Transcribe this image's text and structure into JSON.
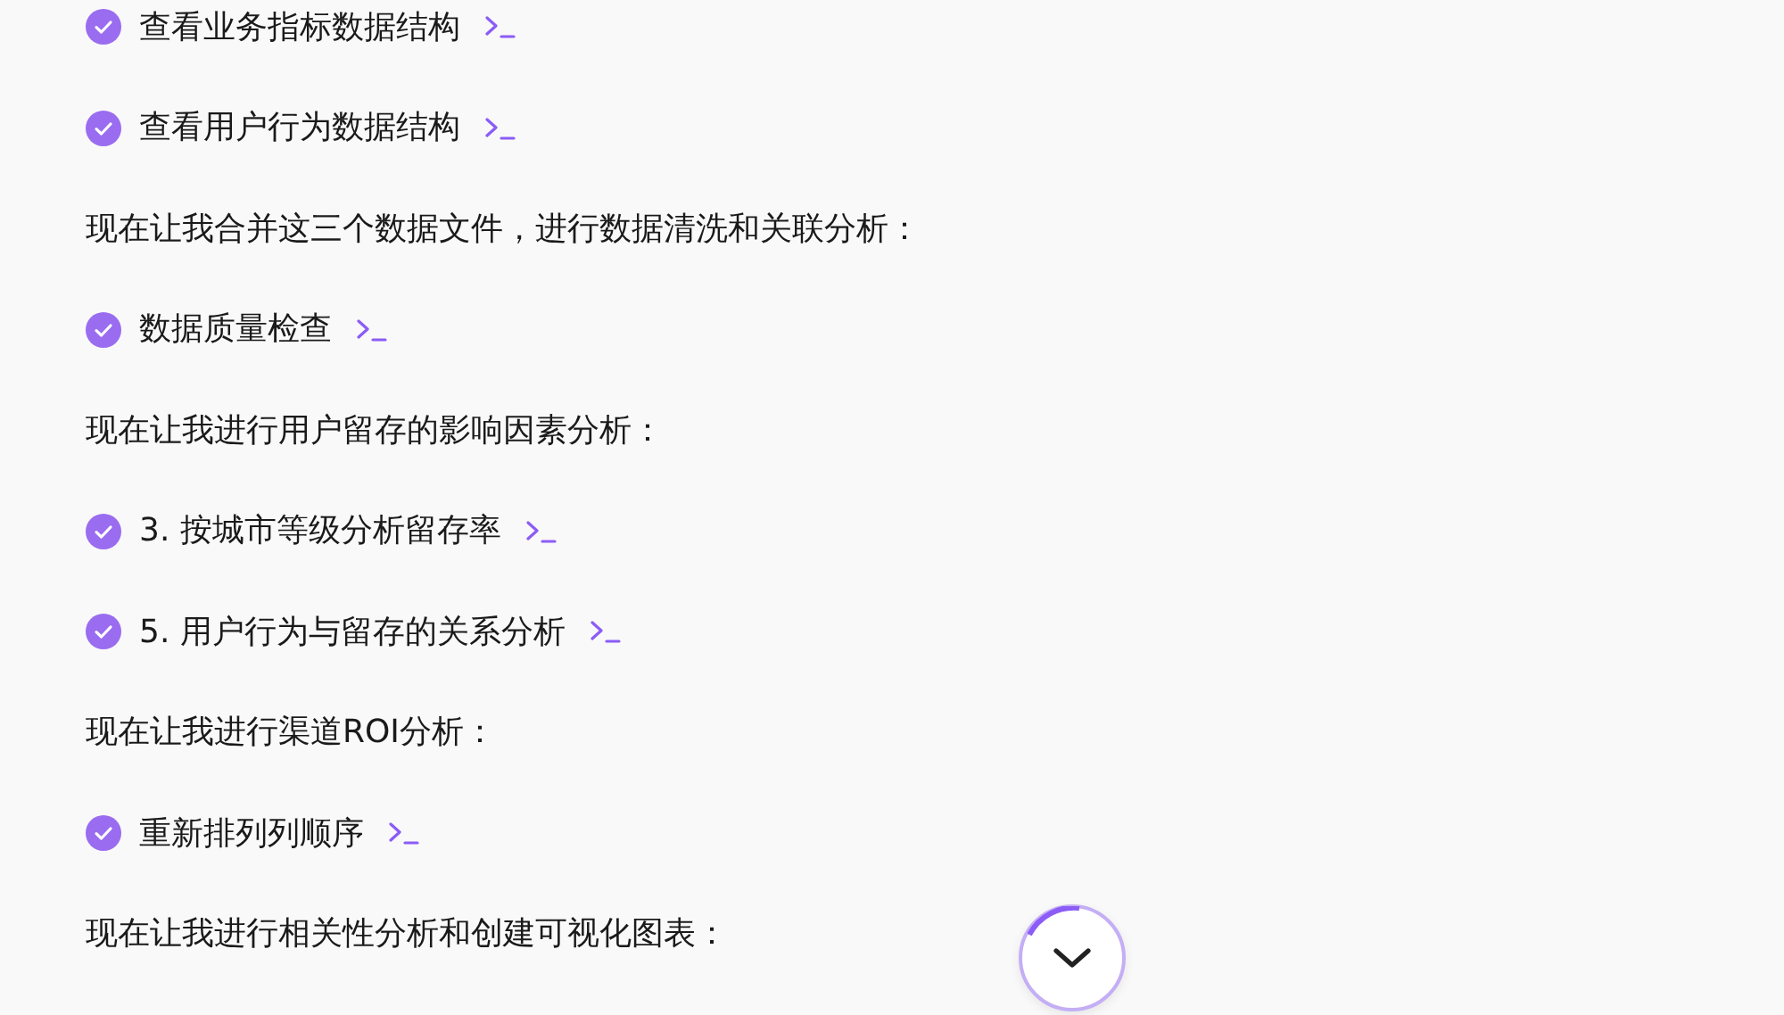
{
  "messages": [
    {
      "kind": "step",
      "label": "查看业务指标数据结构",
      "done": true
    },
    {
      "kind": "step",
      "label": "查看用户行为数据结构",
      "done": true
    },
    {
      "kind": "text",
      "text": "现在让我合并这三个数据文件，进行数据清洗和关联分析："
    },
    {
      "kind": "step",
      "label": "数据质量检查",
      "done": true
    },
    {
      "kind": "text",
      "text": "现在让我进行用户留存的影响因素分析："
    },
    {
      "kind": "step",
      "label": "3. 按城市等级分析留存率",
      "done": true
    },
    {
      "kind": "step",
      "label": "5. 用户行为与留存的关系分析",
      "done": true
    },
    {
      "kind": "text",
      "text": "现在让我进行渠道ROI分析："
    },
    {
      "kind": "step",
      "label": "重新排列列顺序",
      "done": true
    },
    {
      "kind": "text",
      "text": "现在让我进行相关性分析和创建可视化图表："
    }
  ]
}
